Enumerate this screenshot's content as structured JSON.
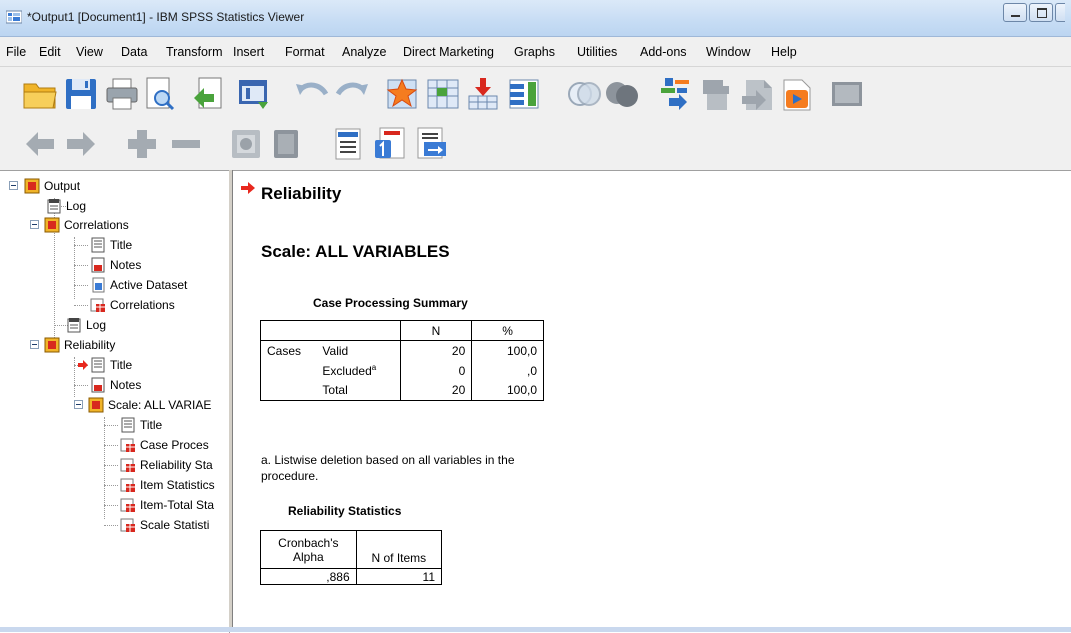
{
  "window": {
    "title": "*Output1 [Document1] - IBM SPSS Statistics Viewer"
  },
  "menu": [
    "File",
    "Edit",
    "View",
    "Data",
    "Transform",
    "Insert",
    "Format",
    "Analyze",
    "Direct Marketing",
    "Graphs",
    "Utilities",
    "Add-ons",
    "Window",
    "Help"
  ],
  "toolbar1": [
    "open-icon",
    "save-icon",
    "print-icon",
    "print-preview-icon",
    "export-icon",
    "recall-dialog-icon",
    "undo-icon",
    "redo-icon",
    "goto-case-icon",
    "goto-variable-icon",
    "insert-output-icon",
    "variables-icon",
    "designate-window-icon",
    "select-last-output-icon",
    "script-icon",
    "promote-icon",
    "demote-icon",
    "show-all-icon",
    "hide-icon"
  ],
  "toolbar2": [
    "back-icon",
    "forward-icon",
    "expand-icon",
    "collapse-icon",
    "show-icon",
    "hide-item-icon",
    "insert-heading-icon",
    "insert-title-icon",
    "insert-text-icon"
  ],
  "tree": {
    "output": "Output",
    "log1": "Log",
    "correlations": "Correlations",
    "corr_title": "Title",
    "corr_notes": "Notes",
    "corr_active": "Active Dataset",
    "corr_corr": "Correlations",
    "log2": "Log",
    "reliability": "Reliability",
    "rel_title": "Title",
    "rel_notes": "Notes",
    "scale": "Scale: ALL VARIAE",
    "scale_title": "Title",
    "scale_case": "Case Proces",
    "scale_relstats": "Reliability Sta",
    "scale_item": "Item Statistics",
    "scale_itemtotal": "Item-Total Sta",
    "scale_scale": "Scale Statisti"
  },
  "output": {
    "heading": "Reliability",
    "subheading": "Scale: ALL VARIABLES",
    "case_table": {
      "title": "Case Processing Summary",
      "col_n": "N",
      "col_pct": "%",
      "group": "Cases",
      "rows": [
        {
          "label": "Valid",
          "n": "20",
          "pct": "100,0"
        },
        {
          "label": "Excluded",
          "sup": "a",
          "n": "0",
          "pct": ",0"
        },
        {
          "label": "Total",
          "n": "20",
          "pct": "100,0"
        }
      ],
      "footnote": "a. Listwise deletion based on all variables in the procedure."
    },
    "rel_table": {
      "title": "Reliability Statistics",
      "col1": "Cronbach's Alpha",
      "col2": "N of Items",
      "alpha": ",886",
      "items": "11"
    }
  },
  "colors": {
    "accent_red": "#e8281e",
    "titlebar": "#c6dcf4"
  }
}
